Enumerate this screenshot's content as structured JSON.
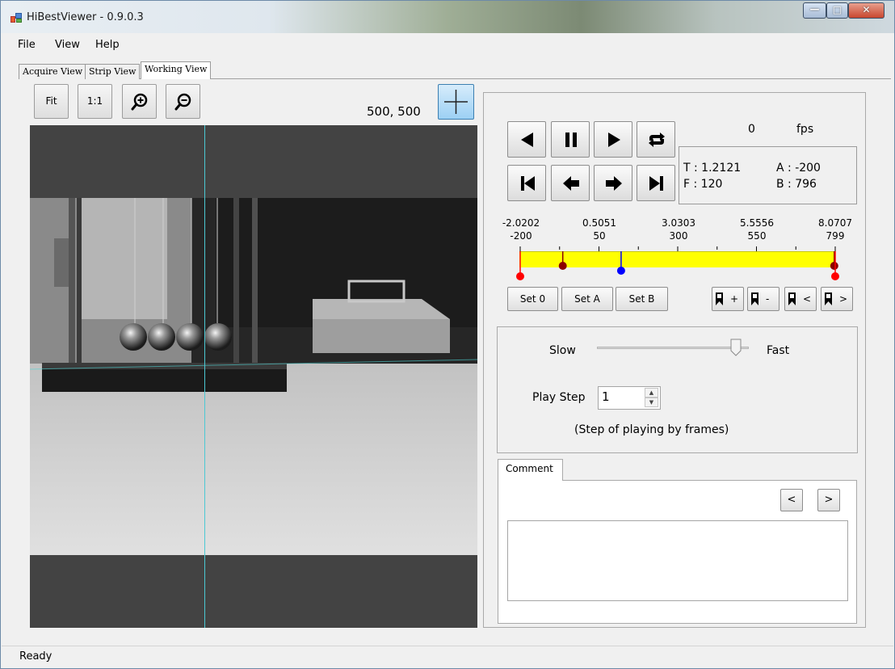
{
  "window": {
    "title": "HiBestViewer - 0.9.0.3"
  },
  "menu": {
    "items": [
      "File",
      "View",
      "Help"
    ]
  },
  "tabs": [
    "Acquire View",
    "Strip View",
    "Working View"
  ],
  "toolbar": {
    "fit_label": "Fit",
    "one_to_one_label": "1:1",
    "coordinates": "500, 500"
  },
  "playback": {
    "fps_value": "0",
    "fps_unit": "fps"
  },
  "info": {
    "t": "T : 1.2121",
    "f": "F : 120",
    "a": "A : -200",
    "b": "B : 796"
  },
  "timeline": {
    "labels": [
      {
        "time": "-2.0202",
        "frame": "-200"
      },
      {
        "time": "0.5051",
        "frame": "50"
      },
      {
        "time": "3.0303",
        "frame": "300"
      },
      {
        "time": "5.5556",
        "frame": "550"
      },
      {
        "time": "8.0707",
        "frame": "799"
      }
    ],
    "frame_min": -200,
    "frame_max": 799,
    "markers": [
      {
        "name": "start-marker",
        "frame": -200,
        "color": "#ff0000"
      },
      {
        "name": "marker-a",
        "frame": -65,
        "color": "#8b0000"
      },
      {
        "name": "current-marker",
        "frame": 120,
        "color": "#0000ff"
      },
      {
        "name": "marker-b",
        "frame": 796,
        "color": "#8b0000"
      },
      {
        "name": "end-marker",
        "frame": 799,
        "color": "#ff0000"
      }
    ]
  },
  "set_buttons": {
    "set0": "Set 0",
    "seta": "Set A",
    "setb": "Set B"
  },
  "bookmark_buttons": {
    "add": "+",
    "remove": "-",
    "prev": "<",
    "next": ">"
  },
  "speed": {
    "slow": "Slow",
    "fast": "Fast",
    "level": 0.95,
    "play_step_label": "Play Step",
    "play_step_value": "1",
    "hint": "(Step of playing by frames)"
  },
  "comment": {
    "tab_label": "Comment",
    "prev": "<",
    "next": ">",
    "text": ""
  },
  "status": {
    "text": "Ready"
  }
}
